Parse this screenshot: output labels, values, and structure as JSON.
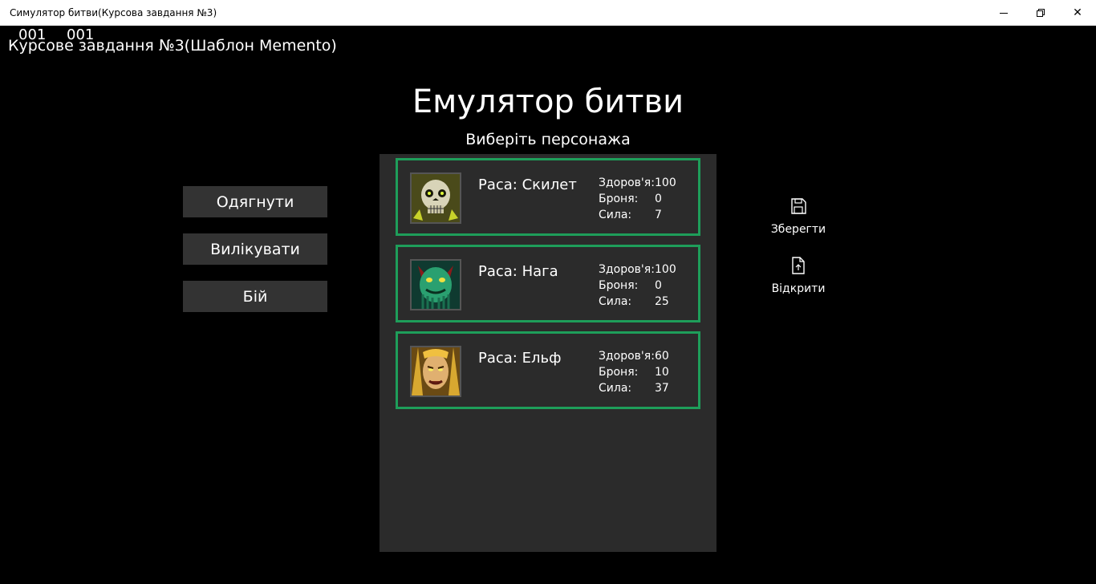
{
  "window": {
    "title": "Симулятор битви(Курсова завдання №3)",
    "minimize_icon": "minimize-icon",
    "maximize_icon": "restore-icon",
    "close_icon": "close-icon",
    "close_glyph": "✕"
  },
  "debug": {
    "counter_1": "001",
    "counter_2": "001"
  },
  "course_title": "Курсове завдання №3(Шаблон Memento)",
  "header": {
    "title": "Емулятор битви",
    "subtitle": "Виберіть персонажа"
  },
  "actions": [
    {
      "label": "Одягнути"
    },
    {
      "label": "Вилікувати"
    },
    {
      "label": "Бій"
    }
  ],
  "characters": [
    {
      "race": "Раса: Скилет",
      "portrait_icon": "skeleton-portrait",
      "stats": [
        {
          "label": "Здоров'я:",
          "value": "100"
        },
        {
          "label": "Броня:",
          "value": "0"
        },
        {
          "label": "Сила:",
          "value": "7"
        }
      ]
    },
    {
      "race": "Раса: Нага",
      "portrait_icon": "naga-portrait",
      "stats": [
        {
          "label": "Здоров'я:",
          "value": "100"
        },
        {
          "label": "Броня:",
          "value": "0"
        },
        {
          "label": "Сила:",
          "value": "25"
        }
      ]
    },
    {
      "race": "Раса: Ельф",
      "portrait_icon": "elf-portrait",
      "stats": [
        {
          "label": "Здоров'я:",
          "value": "60"
        },
        {
          "label": "Броня:",
          "value": "10"
        },
        {
          "label": "Сила:",
          "value": "37"
        }
      ]
    }
  ],
  "side_buttons": {
    "save": {
      "label": "Зберегти",
      "icon": "save-icon"
    },
    "open": {
      "label": "Відкрити",
      "icon": "open-file-icon"
    }
  },
  "colors": {
    "background": "#000000",
    "panel": "#2b2b2b",
    "button": "#333333",
    "card_border": "#1e9e5a"
  }
}
